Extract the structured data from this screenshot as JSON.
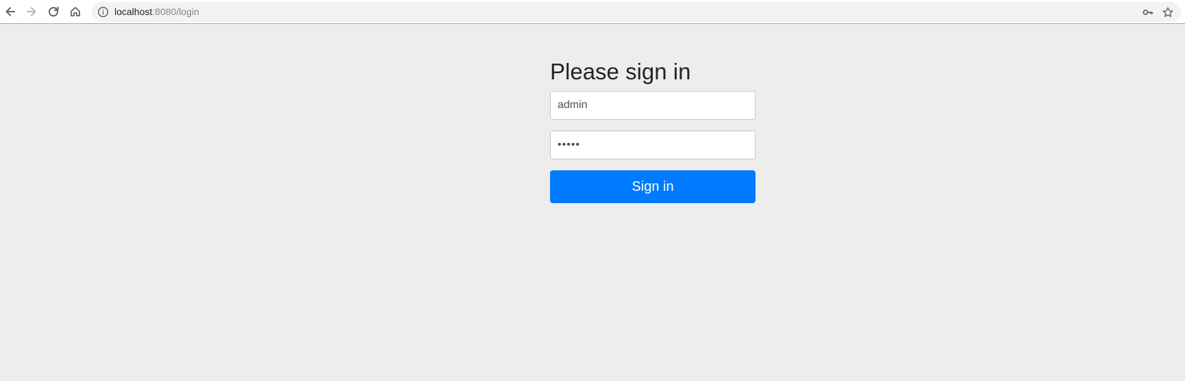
{
  "browser": {
    "url_host": "localhost",
    "url_rest": ":8080/login",
    "icons": [
      "back-arrow-icon",
      "forward-arrow-icon",
      "reload-icon",
      "home-icon",
      "info-icon",
      "key-icon",
      "star-icon"
    ]
  },
  "login": {
    "heading": "Please sign in",
    "username_value": "admin",
    "password_value": "admin",
    "submit_label": "Sign in"
  },
  "colors": {
    "page_background": "#ededed",
    "button": "#007bff",
    "button_text": "#ffffff",
    "heading_text": "#212529"
  }
}
